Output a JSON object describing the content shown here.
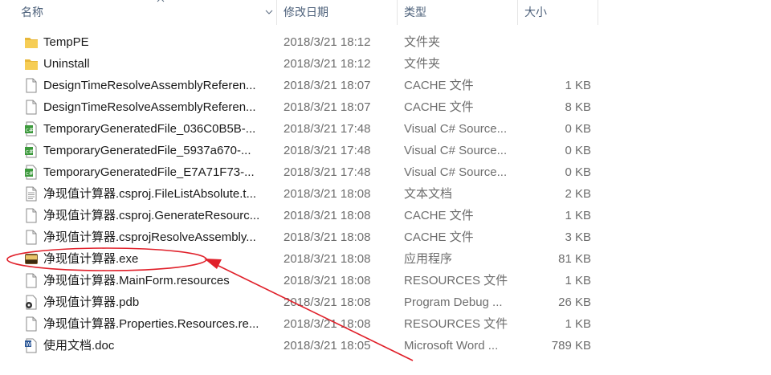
{
  "columns": {
    "name": "名称",
    "date": "修改日期",
    "type": "类型",
    "size": "大小"
  },
  "files": [
    {
      "name": "TempPE",
      "date": "2018/3/21 18:12",
      "type": "文件夹",
      "size": "",
      "icon": "folder-icon"
    },
    {
      "name": "Uninstall",
      "date": "2018/3/21 18:12",
      "type": "文件夹",
      "size": "",
      "icon": "folder-icon"
    },
    {
      "name": "DesignTimeResolveAssemblyReferen...",
      "date": "2018/3/21 18:07",
      "type": "CACHE 文件",
      "size": "1 KB",
      "icon": "file-icon"
    },
    {
      "name": "DesignTimeResolveAssemblyReferen...",
      "date": "2018/3/21 18:07",
      "type": "CACHE 文件",
      "size": "8 KB",
      "icon": "file-icon"
    },
    {
      "name": "TemporaryGeneratedFile_036C0B5B-...",
      "date": "2018/3/21 17:48",
      "type": "Visual C# Source...",
      "size": "0 KB",
      "icon": "csharp-file-icon"
    },
    {
      "name": "TemporaryGeneratedFile_5937a670-...",
      "date": "2018/3/21 17:48",
      "type": "Visual C# Source...",
      "size": "0 KB",
      "icon": "csharp-file-icon"
    },
    {
      "name": "TemporaryGeneratedFile_E7A71F73-...",
      "date": "2018/3/21 17:48",
      "type": "Visual C# Source...",
      "size": "0 KB",
      "icon": "csharp-file-icon"
    },
    {
      "name": "净现值计算器.csproj.FileListAbsolute.t...",
      "date": "2018/3/21 18:08",
      "type": "文本文档",
      "size": "2 KB",
      "icon": "text-file-icon"
    },
    {
      "name": "净现值计算器.csproj.GenerateResourc...",
      "date": "2018/3/21 18:08",
      "type": "CACHE 文件",
      "size": "1 KB",
      "icon": "file-icon"
    },
    {
      "name": "净现值计算器.csprojResolveAssembly...",
      "date": "2018/3/21 18:08",
      "type": "CACHE 文件",
      "size": "3 KB",
      "icon": "file-icon"
    },
    {
      "name": "净现值计算器.exe",
      "date": "2018/3/21 18:08",
      "type": "应用程序",
      "size": "81 KB",
      "icon": "exe-icon"
    },
    {
      "name": "净现值计算器.MainForm.resources",
      "date": "2018/3/21 18:08",
      "type": "RESOURCES 文件",
      "size": "1 KB",
      "icon": "file-icon"
    },
    {
      "name": "净现值计算器.pdb",
      "date": "2018/3/21 18:08",
      "type": "Program Debug ...",
      "size": "26 KB",
      "icon": "pdb-icon"
    },
    {
      "name": "净现值计算器.Properties.Resources.re...",
      "date": "2018/3/21 18:08",
      "type": "RESOURCES 文件",
      "size": "1 KB",
      "icon": "file-icon"
    },
    {
      "name": "使用文档.doc",
      "date": "2018/3/21 18:05",
      "type": "Microsoft Word ...",
      "size": "789 KB",
      "icon": "word-doc-icon"
    }
  ],
  "annotation_color": "#e0202a"
}
